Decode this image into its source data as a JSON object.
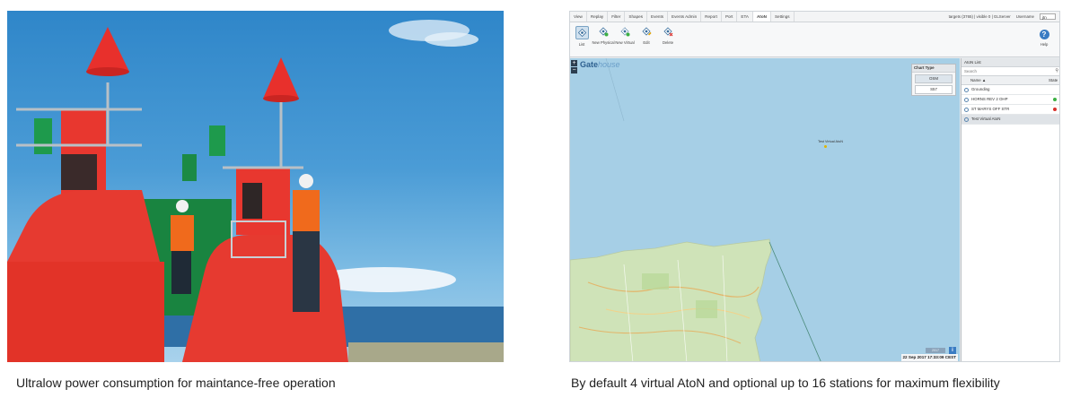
{
  "captions": {
    "left": "Ultralow power consumption for maintance-free operation",
    "right": "By default 4 virtual AtoN and optional up to 16 stations for maximum flexibility"
  },
  "app": {
    "menu": [
      "View",
      "Replay",
      "Filter",
      "Shapes",
      "Events",
      "Events Admin",
      "Report",
      "Port",
      "ETA",
      "AtoN",
      "Settings"
    ],
    "active_menu": "AtoN",
    "status_text": "targets (3765) | visible 0 | GLServer",
    "username_label": "Username",
    "user_value": "jtn",
    "toolbar": [
      {
        "label": "List",
        "icon": "list-icon"
      },
      {
        "label": "New Physical",
        "icon": "new-physical-icon"
      },
      {
        "label": "New Virtual",
        "icon": "new-virtual-icon"
      },
      {
        "label": "Edit",
        "icon": "edit-icon"
      },
      {
        "label": "Delete",
        "icon": "delete-icon"
      }
    ],
    "help_label": "Help",
    "map": {
      "logo_main": "Gate",
      "logo_sub": "house",
      "zoom_in": "+",
      "zoom_out": "−",
      "chart_type": {
        "title": "Chart Type",
        "options": [
          "OSM",
          "S57"
        ],
        "selected": "OSM"
      },
      "marker_label": "Test Virtual AtoN",
      "control_label": "2017",
      "info": "i",
      "timestamp": "22 Sep 2017 17:33:09 CEST"
    },
    "panel": {
      "title": "AtoN List",
      "search_placeholder": "Search",
      "col_name": "Name ▲",
      "col_state": "State",
      "rows": [
        {
          "name": "Grounding",
          "state": ""
        },
        {
          "name": "HORNS REV 2 OHP",
          "state": "green"
        },
        {
          "name": "ST MARYS OFF STR",
          "state": "red"
        },
        {
          "name": "Test Virtual AtoN",
          "state": ""
        }
      ]
    },
    "colors": {
      "accent": "#3a7cc3",
      "state_green": "#3cb043",
      "state_red": "#d9302c",
      "sea": "#a6cfe6",
      "land": "#cfe3b8"
    }
  }
}
